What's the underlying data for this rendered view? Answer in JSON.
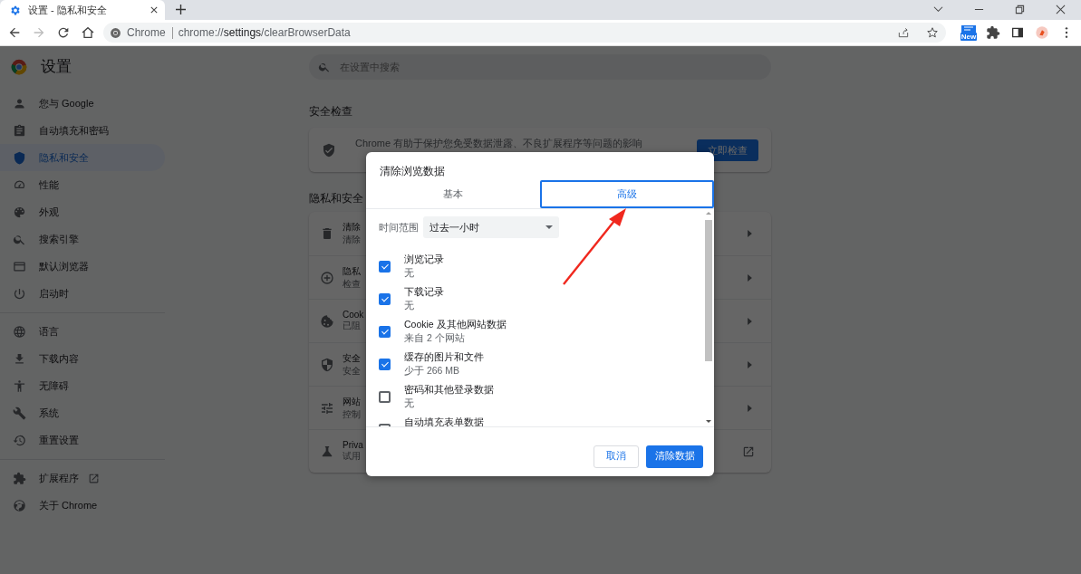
{
  "browser": {
    "tab": {
      "title": "设置 - 隐私和安全"
    },
    "address": {
      "origin": "Chrome",
      "url": "chrome://**settings**/clearBrowserData"
    },
    "extension_badge": "New"
  },
  "settings": {
    "title": "设置",
    "search": {
      "placeholder": "在设置中搜索"
    },
    "sidebar": {
      "groups": [
        [
          {
            "label": "您与 Google",
            "selected": false
          },
          {
            "label": "自动填充和密码",
            "selected": false
          },
          {
            "label": "隐私和安全",
            "selected": true
          },
          {
            "label": "性能",
            "selected": false
          },
          {
            "label": "外观",
            "selected": false
          },
          {
            "label": "搜索引擎",
            "selected": false
          },
          {
            "label": "默认浏览器",
            "selected": false
          },
          {
            "label": "启动时",
            "selected": false
          }
        ],
        [
          {
            "label": "语言",
            "selected": false
          },
          {
            "label": "下载内容",
            "selected": false
          },
          {
            "label": "无障碍",
            "selected": false
          },
          {
            "label": "系统",
            "selected": false
          },
          {
            "label": "重置设置",
            "selected": false
          }
        ],
        [
          {
            "label": "扩展程序",
            "selected": false,
            "external": true
          },
          {
            "label": "关于 Chrome",
            "selected": false,
            "external": false
          }
        ]
      ]
    },
    "safety_check": {
      "heading": "安全检查",
      "text": "Chrome 有助于保护您免受数据泄露、不良扩展程序等问题的影响",
      "button": "立即检查"
    },
    "privacy": {
      "heading": "隐私和安全",
      "rows": [
        {
          "title": "清除",
          "subtitle": "清除",
          "kind": "link"
        },
        {
          "title": "隐私",
          "subtitle": "检查",
          "kind": "link"
        },
        {
          "title": "Cook",
          "subtitle": "已阻",
          "kind": "link"
        },
        {
          "title": "安全",
          "subtitle": "安全",
          "kind": "link"
        },
        {
          "title": "网站",
          "subtitle": "控制",
          "kind": "link"
        },
        {
          "title": "Priva",
          "subtitle": "试用",
          "kind": "external"
        }
      ]
    }
  },
  "dialog": {
    "title": "清除浏览数据",
    "tabs": [
      {
        "label": "基本",
        "selected": false
      },
      {
        "label": "高级",
        "selected": true
      }
    ],
    "time_range": {
      "label": "时间范围",
      "value": "过去一小时"
    },
    "items": [
      {
        "label": "浏览记录",
        "detail": "无",
        "checked": true
      },
      {
        "label": "下载记录",
        "detail": "无",
        "checked": true
      },
      {
        "label": "Cookie 及其他网站数据",
        "detail": "来自 2 个网站",
        "checked": true
      },
      {
        "label": "缓存的图片和文件",
        "detail": "少于 266 MB",
        "checked": true
      },
      {
        "label": "密码和其他登录数据",
        "detail": "无",
        "checked": false
      },
      {
        "label": "自动填充表单数据",
        "checked": false
      }
    ],
    "buttons": [
      {
        "label": "取消",
        "kind": "secondary"
      },
      {
        "label": "清除数据",
        "kind": "primary"
      }
    ]
  }
}
